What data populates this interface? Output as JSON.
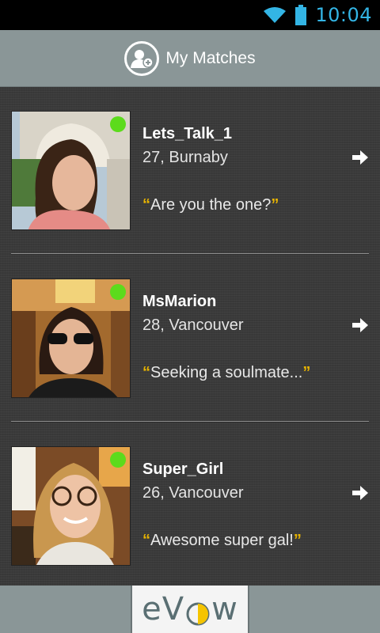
{
  "status_bar": {
    "time": "10:04",
    "icons": [
      "wifi-icon",
      "battery-icon"
    ]
  },
  "header": {
    "title": "My Matches",
    "icon": "matches-user-icon"
  },
  "matches": [
    {
      "name": "Lets_Talk_1",
      "meta": "27, Burnaby",
      "quote": "Are you the one?",
      "online": true
    },
    {
      "name": "MsMarion",
      "meta": "28, Vancouver",
      "quote": "Seeking a soulmate...",
      "online": true
    },
    {
      "name": "Super_Girl",
      "meta": "26, Vancouver",
      "quote": "Awesome super gal!",
      "online": true
    }
  ],
  "footer": {
    "logo": "eVow"
  },
  "colors": {
    "header_bg": "#8a9697",
    "online": "#5cdb1c",
    "quote_mark": "#e8b400",
    "clock": "#33b5e5"
  }
}
